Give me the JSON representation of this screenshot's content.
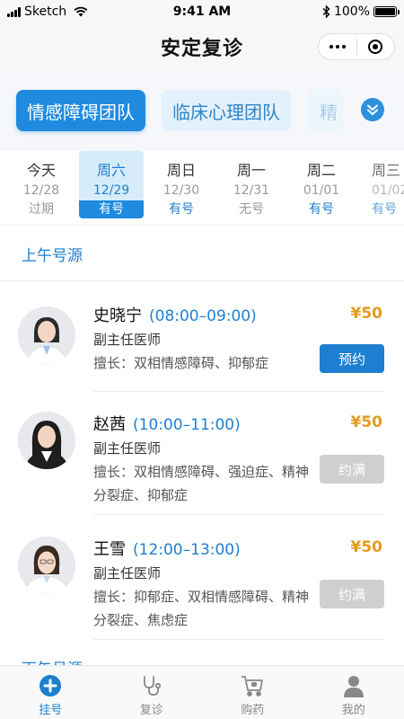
{
  "status_bar": {
    "carrier": "Sketch",
    "time": "9:41 AM",
    "battery": "100%"
  },
  "nav": {
    "title": "安定复诊"
  },
  "teams": {
    "items": [
      {
        "label": "情感障碍团队"
      },
      {
        "label": "临床心理团队"
      },
      {
        "label": "精"
      }
    ]
  },
  "dates": [
    {
      "day": "今天",
      "date": "12/28",
      "status": "过期"
    },
    {
      "day": "周六",
      "date": "12/29",
      "status": "有号"
    },
    {
      "day": "周日",
      "date": "12/30",
      "status": "有号"
    },
    {
      "day": "周一",
      "date": "12/31",
      "status": "无号"
    },
    {
      "day": "周二",
      "date": "01/01",
      "status": "有号"
    },
    {
      "day": "周三",
      "date": "01/02",
      "status": "有号"
    }
  ],
  "morning_title": "上午号源",
  "afternoon_title": "下午号源",
  "doctors": [
    {
      "name": "史晓宁",
      "time": "(08:00–09:00)",
      "title": "副主任医师",
      "specialty": "擅长：双相情感障碍、抑郁症",
      "price": "¥50",
      "button": "预约"
    },
    {
      "name": "赵茜",
      "time": "(10:00–11:00)",
      "title": "副主任医师",
      "specialty": "擅长：双相情感障碍、强迫症、精神分裂症、抑郁症",
      "price": "¥50",
      "button": "约满"
    },
    {
      "name": "王雪",
      "time": "(12:00–13:00)",
      "title": "副主任医师",
      "specialty": "擅长：抑郁症、双相情感障碍、精神分裂症、焦虑症",
      "price": "¥50",
      "button": "约满"
    }
  ],
  "tabbar": [
    {
      "label": "挂号",
      "icon": "plus-circle-icon"
    },
    {
      "label": "复诊",
      "icon": "stethoscope-icon"
    },
    {
      "label": "购药",
      "icon": "cart-icon"
    },
    {
      "label": "我的",
      "icon": "user-icon"
    }
  ],
  "colors": {
    "primary": "#1e8be0",
    "price": "#e39b1c",
    "full": "#cfcfcf"
  }
}
